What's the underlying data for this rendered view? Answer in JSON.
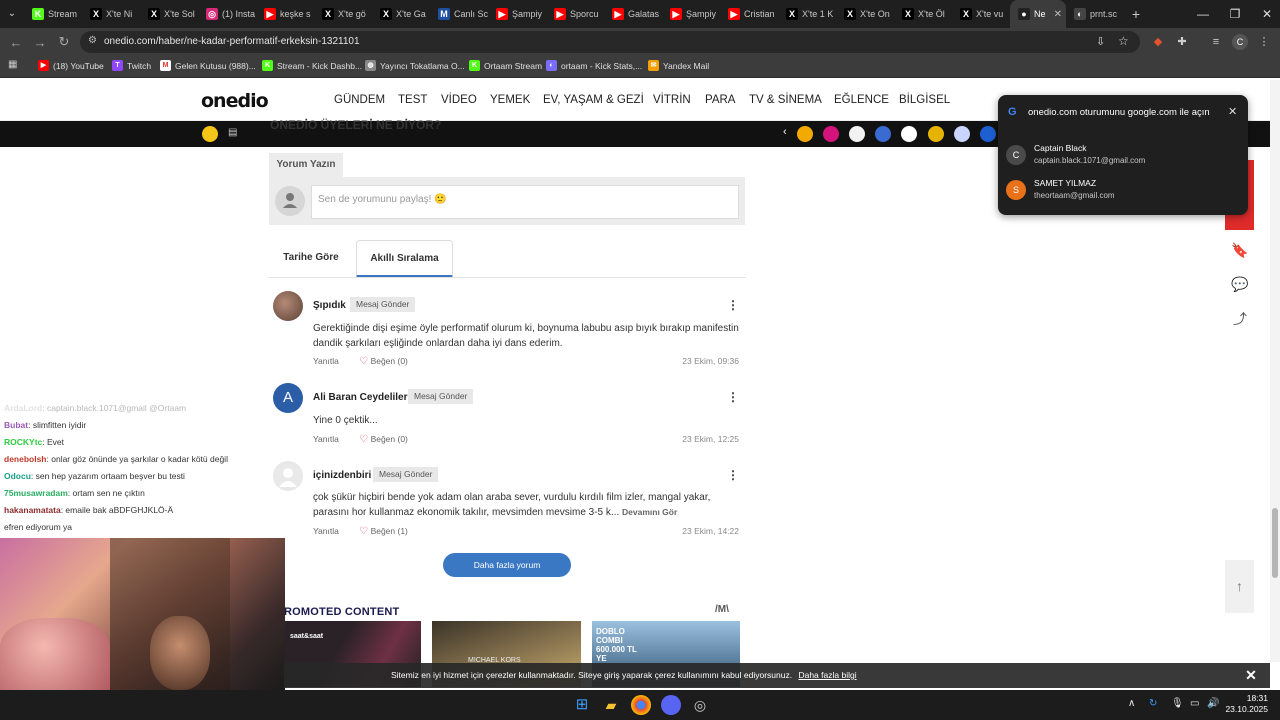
{
  "browser": {
    "tabs": [
      {
        "label": "Stream",
        "color": "#53fc18",
        "glyph": "K"
      },
      {
        "label": "X'te Ni",
        "color": "#000000",
        "glyph": "X"
      },
      {
        "label": "X'te Sol",
        "color": "#000000",
        "glyph": "X"
      },
      {
        "label": "(1) Insta",
        "color": "#d62976",
        "glyph": "◎"
      },
      {
        "label": "keşke s",
        "color": "#ff0000",
        "glyph": "▶"
      },
      {
        "label": "X'te gö",
        "color": "#000000",
        "glyph": "X"
      },
      {
        "label": "X'te Ga",
        "color": "#000000",
        "glyph": "X"
      },
      {
        "label": "Canlı Sc",
        "color": "#1e4fa1",
        "glyph": "M"
      },
      {
        "label": "Şampiy",
        "color": "#ff0000",
        "glyph": "▶"
      },
      {
        "label": "Sporcu",
        "color": "#ff0000",
        "glyph": "▶"
      },
      {
        "label": "Galatas",
        "color": "#ff0000",
        "glyph": "▶"
      },
      {
        "label": "Şampiy",
        "color": "#ff0000",
        "glyph": "▶"
      },
      {
        "label": "Cristian",
        "color": "#ff0000",
        "glyph": "▶"
      },
      {
        "label": "X'te 1 K",
        "color": "#000000",
        "glyph": "X"
      },
      {
        "label": "X'te On",
        "color": "#000000",
        "glyph": "X"
      },
      {
        "label": "X'te Öl",
        "color": "#000000",
        "glyph": "X"
      },
      {
        "label": "X'te vu",
        "color": "#000000",
        "glyph": "X"
      },
      {
        "label": "Ne",
        "color": "#222222",
        "glyph": "●",
        "active": true
      },
      {
        "label": "prnt.sc",
        "color": "#444444",
        "glyph": "◐"
      }
    ],
    "url": "onedio.com/haber/ne-kadar-performatif-erkeksin-1321101",
    "bookmarks": [
      {
        "label": "(18) YouTube",
        "color": "#ff0000",
        "glyph": "▶"
      },
      {
        "label": "Twitch",
        "color": "#9146ff",
        "glyph": "T"
      },
      {
        "label": "Gelen Kutusu (988)...",
        "color": "#ffffff",
        "glyph": "M"
      },
      {
        "label": "Stream - Kick Dashb...",
        "color": "#53fc18",
        "glyph": "K"
      },
      {
        "label": "Yayıncı Tokatlama O...",
        "color": "#888888",
        "glyph": "◍"
      },
      {
        "label": "Ortaam Stream",
        "color": "#53fc18",
        "glyph": "K"
      },
      {
        "label": "ortaam - Kick Stats,...",
        "color": "#7a6cff",
        "glyph": "◐"
      },
      {
        "label": "Yandex Mail",
        "color": "#f4a000",
        "glyph": "✉"
      }
    ]
  },
  "site": {
    "logo": "onedio",
    "nav": [
      "GÜNDEM",
      "TEST",
      "VİDEO",
      "YEMEK",
      "EV, YAŞAM & GEZİ",
      "VİTRİN",
      "PARA",
      "TV & SİNEMA",
      "EĞLENCE",
      "BİLGİSEL"
    ],
    "subbar_heading": "ONEDİO ÜYELERİ NE DİYOR?"
  },
  "comments_section": {
    "write_tab": "Yorum Yazın",
    "input_placeholder": "Sen de yorumunu paylaş! 🙂",
    "sort_tabs": [
      "Tarihe Göre",
      "Akıllı Sıralama"
    ],
    "active_sort": "Akıllı Sıralama",
    "message_button": "Mesaj Gönder",
    "reply_label": "Yanıtla",
    "comments": [
      {
        "author": "Şıpıdık",
        "avatar_color": "#8a6a5a",
        "avatar_letter": "",
        "text": "Gerektiğinde dişi eşime öyle performatif olurum ki, boynuma labubu asıp bıyık bırakıp manifestin dandik şarkıları eşliğinde onlardan daha iyi dans ederim.",
        "likes": "Beğen (0)",
        "date": "23 Ekim, 09:36"
      },
      {
        "author": "Ali Baran Ceydeliler",
        "avatar_color": "#2b5ea6",
        "avatar_letter": "A",
        "text": "Yine 0 çektik...",
        "likes": "Beğen (0)",
        "date": "23 Ekim, 12:25"
      },
      {
        "author": "içinizdenbiri",
        "avatar_color": "#e5e5e5",
        "avatar_letter": "",
        "text": "çok şükür hiçbiri bende yok adam olan araba sever, vurdulu kırdılı film izler, mangal yakar, parasını hor kullanmaz ekonomik takılır, mevsimden mevsime 3-5 k...",
        "more": "Devamını Gör",
        "likes": "Beğen (1)",
        "date": "23 Ekim, 14:22"
      }
    ],
    "more_button": "Daha fazla yorum"
  },
  "promoted": {
    "heading": "ROMOTED CONTENT",
    "logo": "/M\\",
    "items": [
      {
        "label": "saat&saat",
        "color": "#2a2226"
      },
      {
        "label": "MICHAEL KORS",
        "color": "#6b5a3e"
      },
      {
        "label": "DOBLO COMBI 600.000 TL YE",
        "color": "#2e5b8a"
      }
    ]
  },
  "google_popup": {
    "title": "onedio.com oturumunu google.com ile açın",
    "accounts": [
      {
        "name": "Captain Black",
        "email": "captain.black.1071@gmail.com",
        "initial": "C",
        "color": "#4a4a4a"
      },
      {
        "name": "SAMET YILMAZ",
        "email": "theortaam@gmail.com",
        "initial": "S",
        "color": "#e8711a"
      }
    ]
  },
  "stream_chat": [
    {
      "user": "ArdaLord",
      "msg": ": captain.black.1071@gmail @Ortaam",
      "color": "#aaaaaa",
      "faded": true
    },
    {
      "user": "Bubat",
      "msg": ": slimfitten iyidir",
      "color": "#9b59b6"
    },
    {
      "user": "ROCKYtc",
      "msg": ": Evet",
      "color": "#2ecc40"
    },
    {
      "user": "denebolsh",
      "msg": ": onlar göz önünde ya şarkılar o kadar kötü değil",
      "color": "#c0392b"
    },
    {
      "user": "Odocu",
      "msg": ": sen hep yazarım ortaam beşver bu testi",
      "color": "#16a085"
    },
    {
      "user": "75musawradam",
      "msg": ": ortam sen ne çıktın",
      "color": "#27ae60"
    },
    {
      "user": "hakanamatata",
      "msg": ": emaile bak aBDFGHJKLÖ-Ä",
      "color": "#8e2d2d"
    },
    {
      "user": "",
      "msg": "efren ediyorum ya",
      "color": "#333333"
    }
  ],
  "cookie": {
    "text": "Sitemiz en iyi hizmet için çerezler kullanmaktadır. Siteye giriş yaparak çerez kullanımını kabul ediyorsunuz.",
    "link": "Daha fazla bilgi"
  },
  "taskbar": {
    "time": "18:31",
    "date": "23.10.2025"
  }
}
